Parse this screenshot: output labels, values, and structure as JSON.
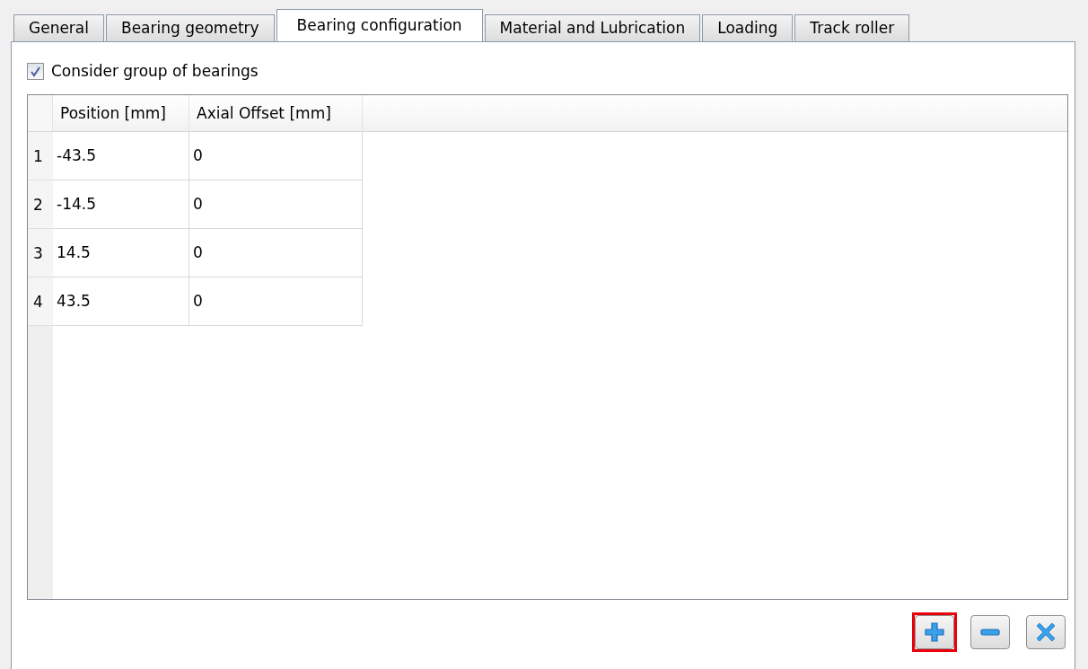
{
  "tabs": [
    {
      "label": "General",
      "selected": false
    },
    {
      "label": "Bearing geometry",
      "selected": false
    },
    {
      "label": "Bearing configuration",
      "selected": true
    },
    {
      "label": "Material and Lubrication",
      "selected": false
    },
    {
      "label": "Loading",
      "selected": false
    },
    {
      "label": "Track roller",
      "selected": false
    }
  ],
  "group_checkbox": {
    "label": "Consider group of bearings",
    "checked": true
  },
  "table": {
    "columns": [
      "Position [mm]",
      "Axial Offset [mm]"
    ],
    "rows": [
      {
        "index": "1",
        "cells": [
          "-43.5",
          "0"
        ]
      },
      {
        "index": "2",
        "cells": [
          "-14.5",
          "0"
        ]
      },
      {
        "index": "3",
        "cells": [
          "14.5",
          "0"
        ]
      },
      {
        "index": "4",
        "cells": [
          "43.5",
          "0"
        ]
      }
    ]
  },
  "buttons": [
    {
      "kind": "add",
      "highlighted": true
    },
    {
      "kind": "remove",
      "highlighted": false
    },
    {
      "kind": "clear",
      "highlighted": false
    }
  ]
}
